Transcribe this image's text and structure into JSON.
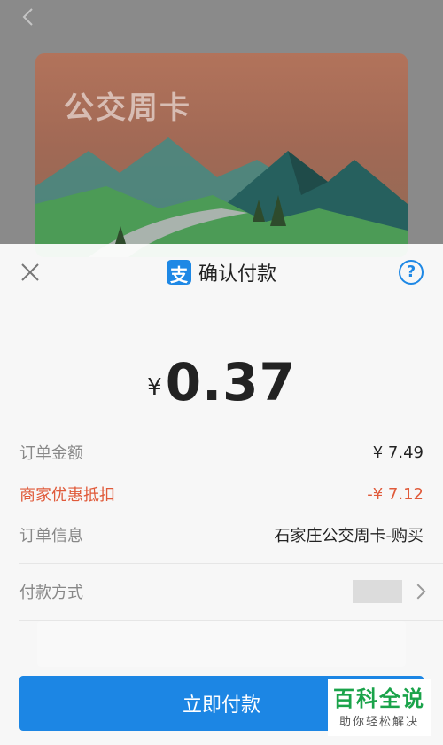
{
  "background": {
    "card_title": "公交周卡"
  },
  "sheet": {
    "title": "确认付款",
    "logo_glyph": "支",
    "help_glyph": "?",
    "currency": "¥",
    "amount": "0.37",
    "rows": [
      {
        "label": "订单金额",
        "value": "¥ 7.49"
      },
      {
        "label": "商家优惠抵扣",
        "value": "-¥ 7.12"
      },
      {
        "label": "订单信息",
        "value": "石家庄公交周卡-购买"
      },
      {
        "label": "付款方式",
        "value": ""
      }
    ],
    "pay_button": "立即付款",
    "accent": "#1c86e4",
    "discount_color": "#e05a3a"
  },
  "watermark": {
    "big": "百科全说",
    "small": "助你轻松解决"
  }
}
